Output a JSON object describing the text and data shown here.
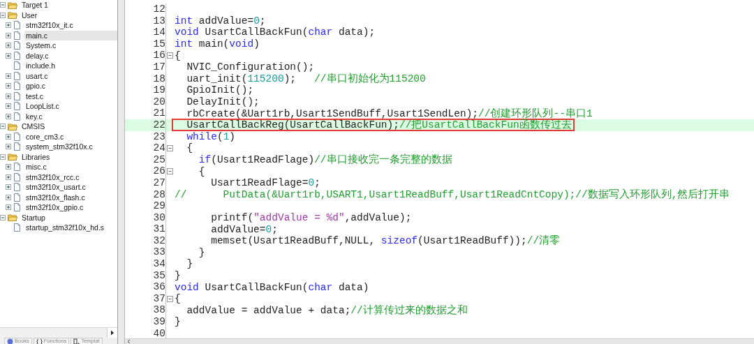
{
  "project_tree": [
    {
      "label": "Target 1",
      "expanded": true,
      "selected": false,
      "children": [
        {
          "label": "User",
          "expanded": true,
          "selected": false,
          "children": [
            {
              "label": "stm32f10x_it.c",
              "expandable": true,
              "selected": false
            },
            {
              "label": "main.c",
              "expandable": true,
              "selected": true
            },
            {
              "label": "System.c",
              "expandable": true,
              "selected": false
            },
            {
              "label": "delay.c",
              "expandable": true,
              "selected": false
            },
            {
              "label": "include.h",
              "expandable": false,
              "selected": false
            },
            {
              "label": "usart.c",
              "expandable": true,
              "selected": false
            },
            {
              "label": "gpio.c",
              "expandable": true,
              "selected": false
            },
            {
              "label": "test.c",
              "expandable": true,
              "selected": false
            },
            {
              "label": "LoopList.c",
              "expandable": true,
              "selected": false
            },
            {
              "label": "key.c",
              "expandable": true,
              "selected": false
            }
          ]
        },
        {
          "label": "CMSIS",
          "expanded": true,
          "selected": false,
          "children": [
            {
              "label": "core_cm3.c",
              "expandable": true,
              "selected": false
            },
            {
              "label": "system_stm32f10x.c",
              "expandable": true,
              "selected": false
            }
          ]
        },
        {
          "label": "Libraries",
          "expanded": true,
          "selected": false,
          "children": [
            {
              "label": "misc.c",
              "expandable": true,
              "selected": false
            },
            {
              "label": "stm32f10x_rcc.c",
              "expandable": true,
              "selected": false
            },
            {
              "label": "stm32f10x_usart.c",
              "expandable": true,
              "selected": false
            },
            {
              "label": "stm32f10x_flash.c",
              "expandable": true,
              "selected": false
            },
            {
              "label": "stm32f10x_gpio.c",
              "expandable": true,
              "selected": false
            }
          ]
        },
        {
          "label": "Startup",
          "expanded": true,
          "selected": false,
          "children": [
            {
              "label": "startup_stm32f10x_hd.s",
              "expandable": false,
              "selected": false
            }
          ]
        }
      ]
    }
  ],
  "panel_tabs": [
    {
      "label": "Books",
      "kind": "books",
      "selected": false
    },
    {
      "label": "Functions",
      "kind": "functions",
      "selected": false
    },
    {
      "label": "Templat",
      "kind": "templates",
      "selected": false
    }
  ],
  "code_lines": [
    {
      "number": "12",
      "collapsible": false,
      "highlighted": false,
      "boxed": false
    },
    {
      "number": "13",
      "collapsible": false,
      "highlighted": false,
      "boxed": false,
      "tokens": [
        {
          "kind": "keyword",
          "text": "int"
        },
        {
          "kind": "plain",
          "text": " addValue="
        },
        {
          "kind": "number",
          "text": "0"
        },
        {
          "kind": "plain",
          "text": ";"
        }
      ]
    },
    {
      "number": "14",
      "collapsible": false,
      "highlighted": false,
      "boxed": false,
      "tokens": [
        {
          "kind": "keyword",
          "text": "void"
        },
        {
          "kind": "plain",
          "text": " UsartCallBackFun("
        },
        {
          "kind": "keyword",
          "text": "char"
        },
        {
          "kind": "plain",
          "text": " data);"
        }
      ]
    },
    {
      "number": "15",
      "collapsible": false,
      "highlighted": false,
      "boxed": false,
      "tokens": [
        {
          "kind": "keyword",
          "text": "int"
        },
        {
          "kind": "plain",
          "text": " main("
        },
        {
          "kind": "keyword",
          "text": "void"
        },
        {
          "kind": "plain",
          "text": ")"
        }
      ]
    },
    {
      "number": "16",
      "collapsible": true,
      "highlighted": false,
      "boxed": false,
      "tokens": [
        {
          "kind": "plain",
          "text": "{"
        }
      ]
    },
    {
      "number": "17",
      "collapsible": false,
      "highlighted": false,
      "boxed": false,
      "tokens": [
        {
          "kind": "plain",
          "text": "  NVIC_Configuration();"
        }
      ]
    },
    {
      "number": "18",
      "collapsible": false,
      "highlighted": false,
      "boxed": false,
      "tokens": [
        {
          "kind": "plain",
          "text": "  uart_init("
        },
        {
          "kind": "number",
          "text": "115200"
        },
        {
          "kind": "plain",
          "text": ");   "
        },
        {
          "kind": "comment",
          "text": "//串口初始化为115200"
        }
      ]
    },
    {
      "number": "19",
      "collapsible": false,
      "highlighted": false,
      "boxed": false,
      "tokens": [
        {
          "kind": "plain",
          "text": "  GpioInit();"
        }
      ]
    },
    {
      "number": "20",
      "collapsible": false,
      "highlighted": false,
      "boxed": false,
      "tokens": [
        {
          "kind": "plain",
          "text": "  DelayInit();"
        }
      ]
    },
    {
      "number": "21",
      "collapsible": false,
      "highlighted": false,
      "boxed": false,
      "tokens": [
        {
          "kind": "plain",
          "text": "  rbCreate(&Uart1rb,Usart1SendBuff,Usart1SendLen);"
        },
        {
          "kind": "comment",
          "text": "//创建环形队列--串口1"
        }
      ]
    },
    {
      "number": "22",
      "collapsible": false,
      "highlighted": true,
      "boxed": true,
      "tokens": [
        {
          "kind": "plain",
          "text": "  UsartCallBackReg(UsartCallBackFun);"
        },
        {
          "kind": "comment",
          "text": "//把UsartCallBackFun函数传过去"
        }
      ]
    },
    {
      "number": "23",
      "collapsible": false,
      "highlighted": false,
      "boxed": false,
      "tokens": [
        {
          "kind": "keyword",
          "text": "  while"
        },
        {
          "kind": "plain",
          "text": "("
        },
        {
          "kind": "number",
          "text": "1"
        },
        {
          "kind": "plain",
          "text": ")"
        }
      ]
    },
    {
      "number": "24",
      "collapsible": true,
      "highlighted": false,
      "boxed": false,
      "tokens": [
        {
          "kind": "plain",
          "text": "  {"
        }
      ]
    },
    {
      "number": "25",
      "collapsible": false,
      "highlighted": false,
      "boxed": false,
      "tokens": [
        {
          "kind": "keyword",
          "text": "    if"
        },
        {
          "kind": "plain",
          "text": "(Usart1ReadFlage)"
        },
        {
          "kind": "comment",
          "text": "//串口接收完一条完整的数据"
        }
      ]
    },
    {
      "number": "26",
      "collapsible": true,
      "highlighted": false,
      "boxed": false,
      "tokens": [
        {
          "kind": "plain",
          "text": "    {"
        }
      ]
    },
    {
      "number": "27",
      "collapsible": false,
      "highlighted": false,
      "boxed": false,
      "tokens": [
        {
          "kind": "plain",
          "text": "      Usart1ReadFlage="
        },
        {
          "kind": "number",
          "text": "0"
        },
        {
          "kind": "plain",
          "text": ";"
        }
      ]
    },
    {
      "number": "28",
      "collapsible": false,
      "highlighted": false,
      "boxed": false,
      "tokens": [
        {
          "kind": "comment",
          "text": "//      PutData(&Uart1rb,USART1,Usart1ReadBuff,Usart1ReadCntCopy);//数据写入环形队列,然后打开串"
        }
      ]
    },
    {
      "number": "29",
      "collapsible": false,
      "highlighted": false,
      "boxed": false
    },
    {
      "number": "30",
      "collapsible": false,
      "highlighted": false,
      "boxed": false,
      "tokens": [
        {
          "kind": "plain",
          "text": "      printf("
        },
        {
          "kind": "string",
          "text": "\"addValue = %d\""
        },
        {
          "kind": "plain",
          "text": ",addValue);"
        }
      ]
    },
    {
      "number": "31",
      "collapsible": false,
      "highlighted": false,
      "boxed": false,
      "tokens": [
        {
          "kind": "plain",
          "text": "      addValue="
        },
        {
          "kind": "number",
          "text": "0"
        },
        {
          "kind": "plain",
          "text": ";"
        }
      ]
    },
    {
      "number": "32",
      "collapsible": false,
      "highlighted": false,
      "boxed": false,
      "tokens": [
        {
          "kind": "plain",
          "text": "      memset(Usart1ReadBuff,NULL, "
        },
        {
          "kind": "keyword",
          "text": "sizeof"
        },
        {
          "kind": "plain",
          "text": "(Usart1ReadBuff));"
        },
        {
          "kind": "comment",
          "text": "//清零"
        }
      ]
    },
    {
      "number": "33",
      "collapsible": false,
      "highlighted": false,
      "boxed": false,
      "tokens": [
        {
          "kind": "plain",
          "text": "    }"
        }
      ]
    },
    {
      "number": "34",
      "collapsible": false,
      "highlighted": false,
      "boxed": false,
      "tokens": [
        {
          "kind": "plain",
          "text": "  }"
        }
      ]
    },
    {
      "number": "35",
      "collapsible": false,
      "highlighted": false,
      "boxed": false,
      "tokens": [
        {
          "kind": "plain",
          "text": "}"
        }
      ]
    },
    {
      "number": "36",
      "collapsible": false,
      "highlighted": false,
      "boxed": false,
      "tokens": [
        {
          "kind": "keyword",
          "text": "void"
        },
        {
          "kind": "plain",
          "text": " UsartCallBackFun("
        },
        {
          "kind": "keyword",
          "text": "char"
        },
        {
          "kind": "plain",
          "text": " data)"
        }
      ]
    },
    {
      "number": "37",
      "collapsible": true,
      "highlighted": false,
      "boxed": false,
      "tokens": [
        {
          "kind": "plain",
          "text": "{"
        }
      ]
    },
    {
      "number": "38",
      "collapsible": false,
      "highlighted": false,
      "boxed": false,
      "tokens": [
        {
          "kind": "plain",
          "text": "  addValue = addValue + data;"
        },
        {
          "kind": "comment",
          "text": "//计算传过来的数据之和"
        }
      ]
    },
    {
      "number": "39",
      "collapsible": false,
      "highlighted": false,
      "boxed": false,
      "tokens": [
        {
          "kind": "plain",
          "text": "}"
        }
      ]
    },
    {
      "number": "40",
      "collapsible": false,
      "highlighted": false,
      "boxed": false
    }
  ]
}
